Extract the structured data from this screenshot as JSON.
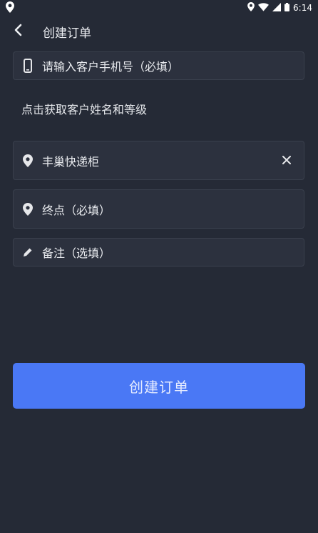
{
  "status_bar": {
    "time": "6:14",
    "icons": [
      "location-icon",
      "wifi-icon",
      "signal-icon",
      "battery-icon"
    ]
  },
  "app_bar": {
    "back_icon": "chevron-left-icon",
    "title": "创建订单"
  },
  "form": {
    "phone": {
      "icon": "phone-icon",
      "placeholder": "请输入客户手机号（必填）"
    },
    "customer_hint": "点击获取客户姓名和等级",
    "start": {
      "icon": "map-pin-icon",
      "value": "丰巢快递柜",
      "clear_icon": "close-icon"
    },
    "end": {
      "icon": "map-pin-icon",
      "placeholder": "终点（必填）"
    },
    "note": {
      "icon": "pencil-icon",
      "placeholder": "备注（选填）"
    },
    "submit_label": "创建订单"
  },
  "colors": {
    "background": "#252a36",
    "field_bg": "#2c313e",
    "accent": "#4a78f5"
  }
}
